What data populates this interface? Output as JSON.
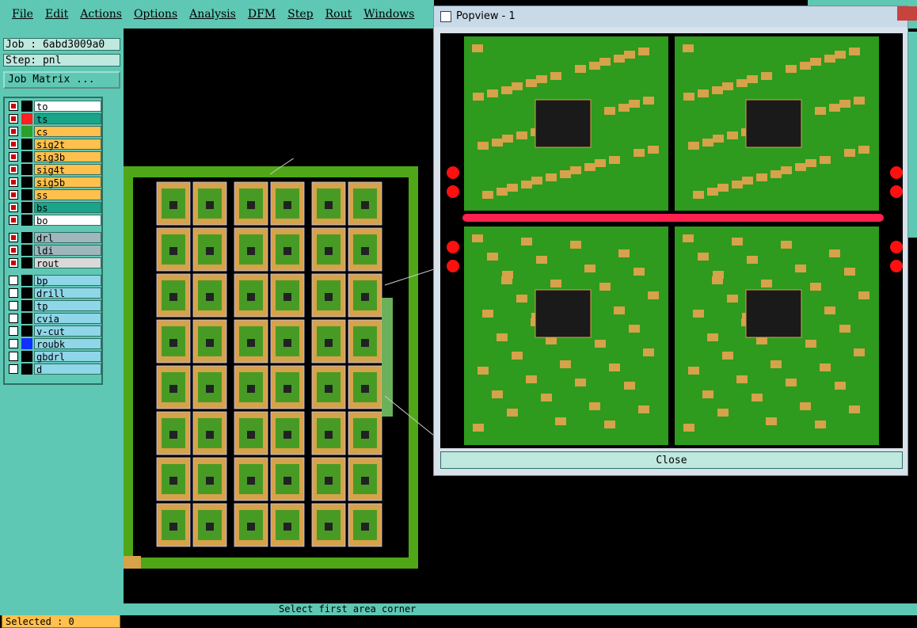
{
  "menu": [
    "File",
    "Edit",
    "Actions",
    "Options",
    "Analysis",
    "DFM",
    "Step",
    "Rout",
    "Windows"
  ],
  "job": {
    "label": "Job : 6abd3009a0",
    "step": "Step: pnl",
    "matrix_button": "Job Matrix ..."
  },
  "layers_board": [
    {
      "name": "to",
      "swatch": "#000000",
      "fill": "#ffffff",
      "on": true
    },
    {
      "name": "ts",
      "swatch": "#ff2020",
      "fill": "#1aa58a",
      "on": true
    },
    {
      "name": "cs",
      "swatch": "#2aa02a",
      "fill": "#ffc04d",
      "on": true
    },
    {
      "name": "sig2t",
      "swatch": "#000000",
      "fill": "#ffc04d",
      "on": true
    },
    {
      "name": "sig3b",
      "swatch": "#000000",
      "fill": "#ffc04d",
      "on": true
    },
    {
      "name": "sig4t",
      "swatch": "#000000",
      "fill": "#ffc04d",
      "on": true
    },
    {
      "name": "sig5b",
      "swatch": "#000000",
      "fill": "#ffc04d",
      "on": true
    },
    {
      "name": "ss",
      "swatch": "#000000",
      "fill": "#ffc04d",
      "on": true
    },
    {
      "name": "bs",
      "swatch": "#000000",
      "fill": "#1aa58a",
      "on": true
    },
    {
      "name": "bo",
      "swatch": "#000000",
      "fill": "#ffffff",
      "on": true
    }
  ],
  "layers_drill": [
    {
      "name": "drl",
      "swatch": "#000000",
      "fill": "#9fb6bd",
      "on": true
    },
    {
      "name": "ldi",
      "swatch": "#000000",
      "fill": "#9fb6bd",
      "on": true
    },
    {
      "name": "rout",
      "swatch": "#000000",
      "fill": "#d9d9d9",
      "on": true
    }
  ],
  "layers_misc": [
    {
      "name": "bp",
      "swatch": "#000000",
      "fill": "#8fd6e8",
      "on": false
    },
    {
      "name": "drill",
      "swatch": "#000000",
      "fill": "#8fd6e8",
      "on": false
    },
    {
      "name": "tp",
      "swatch": "#000000",
      "fill": "#8fd6e8",
      "on": false
    },
    {
      "name": "cvia",
      "swatch": "#000000",
      "fill": "#8fd6e8",
      "on": false
    },
    {
      "name": "v-cut",
      "swatch": "#000000",
      "fill": "#8fd6e8",
      "on": false
    },
    {
      "name": "roubk",
      "swatch": "#1030ff",
      "fill": "#8fd6e8",
      "on": false
    },
    {
      "name": "gbdrl",
      "swatch": "#000000",
      "fill": "#8fd6e8",
      "on": false
    },
    {
      "name": "d",
      "swatch": "#000000",
      "fill": "#8fd6e8",
      "on": false
    }
  ],
  "selected": "Selected : 0",
  "popup": {
    "title": "Popview - 1",
    "close_label": "Close"
  },
  "status": {
    "message": "Select first area corner"
  },
  "colors": {
    "ui": "#5fc8b4",
    "board": "#2e9a1e",
    "copper": "#d6a24a",
    "outline": "#4fa617"
  }
}
